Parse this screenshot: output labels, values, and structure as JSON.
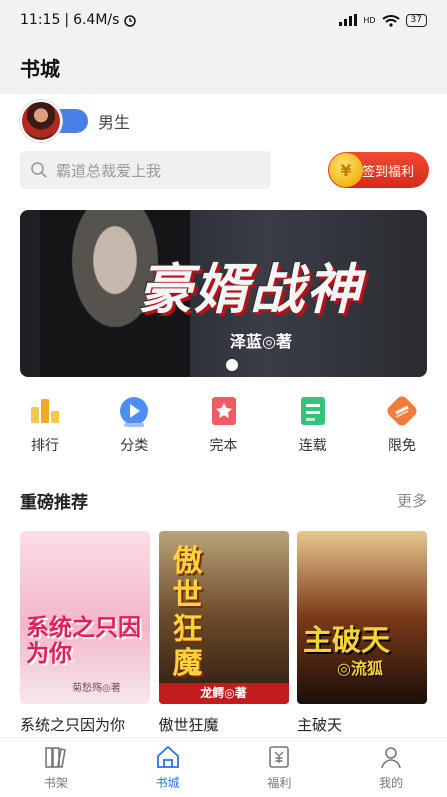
{
  "status_bar": {
    "time": "11:15",
    "network_speed": "6.4M/s",
    "battery": "37",
    "signal_label": "HD"
  },
  "header": {
    "title": "书城"
  },
  "gender": {
    "label": "男生"
  },
  "search": {
    "placeholder": "霸道总裁爱上我"
  },
  "signin": {
    "label": "签到福利",
    "coin_glyph": "¥"
  },
  "banner": {
    "title": "豪婿战神",
    "author": "泽蓝◎著",
    "accent_color": "#b3121b"
  },
  "categories": [
    {
      "label": "排行",
      "icon": "ranking-icon"
    },
    {
      "label": "分类",
      "icon": "category-icon"
    },
    {
      "label": "完本",
      "icon": "finished-book-icon"
    },
    {
      "label": "连载",
      "icon": "serial-icon"
    },
    {
      "label": "限免",
      "icon": "free-limited-icon"
    }
  ],
  "section": {
    "title": "重磅推荐",
    "more": "更多"
  },
  "books": [
    {
      "name": "系统之只因为你",
      "cover_title": "系统之只因为你",
      "cover_author": "菊愁殇◎著"
    },
    {
      "name": "傲世狂魔",
      "cover_title": "傲世狂魔",
      "cover_author": "龙鳄◎著"
    },
    {
      "name": "主破天",
      "cover_title": "主破天",
      "cover_author": "◎流狐"
    }
  ],
  "tabs": [
    {
      "label": "书架",
      "icon": "bookshelf-icon",
      "active": false
    },
    {
      "label": "书城",
      "icon": "bookstore-icon",
      "active": true
    },
    {
      "label": "福利",
      "icon": "welfare-icon",
      "active": false
    },
    {
      "label": "我的",
      "icon": "profile-icon",
      "active": false
    }
  ],
  "colors": {
    "primary": "#2f6fe3",
    "signin_red": "#e0341f",
    "toggle_blue": "#4a7fe6"
  }
}
